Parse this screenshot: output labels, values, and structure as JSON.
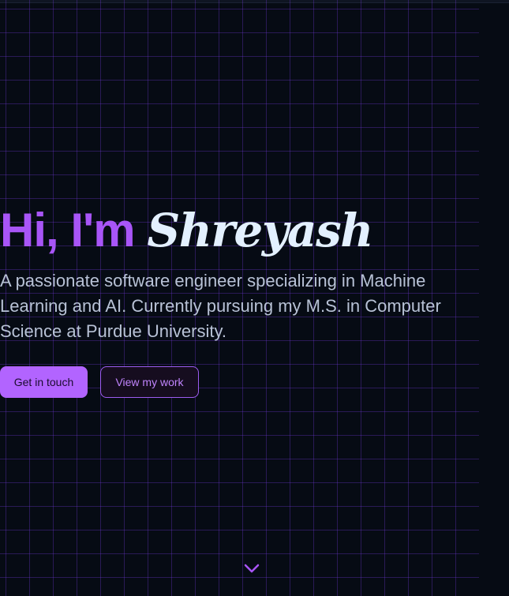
{
  "hero": {
    "greeting": "Hi, I'm",
    "name": "Shreyash",
    "tagline": "A passionate software engineer specializing in Machine Learning and AI. Currently pursuing my M.S. in Computer Science at Purdue University."
  },
  "actions": {
    "primary_label": "Get in touch",
    "secondary_label": "View my work"
  },
  "scroll": {
    "icon": "chevron-down-icon"
  },
  "colors": {
    "accent": "#a855f7",
    "name_text": "#e3f0ff",
    "background": "#060b14",
    "body_text": "#b8c2d6"
  }
}
